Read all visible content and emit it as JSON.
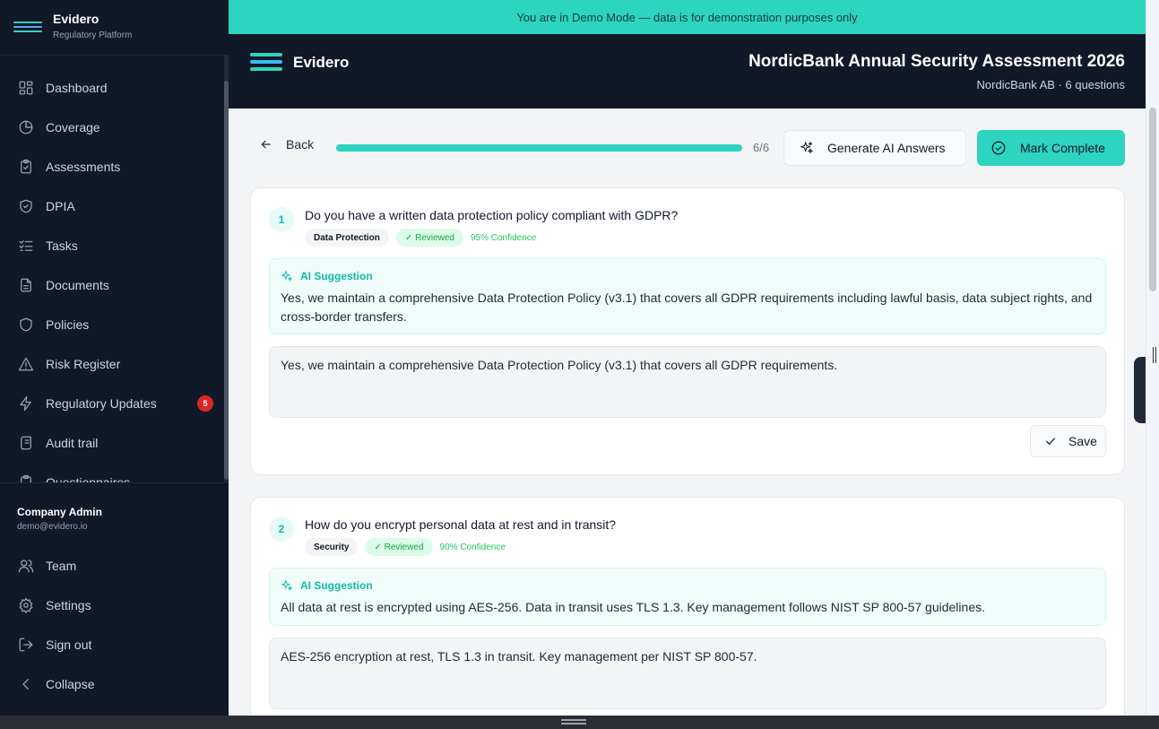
{
  "sidebar": {
    "brand_name": "Evidero",
    "brand_sub": "Regulatory Platform",
    "items": [
      {
        "label": "Dashboard",
        "icon": "dashboard-icon"
      },
      {
        "label": "Coverage",
        "icon": "pie-chart-icon"
      },
      {
        "label": "Assessments",
        "icon": "clipboard-check-icon"
      },
      {
        "label": "DPIA",
        "icon": "shield-check-icon"
      },
      {
        "label": "Tasks",
        "icon": "list-check-icon"
      },
      {
        "label": "Documents",
        "icon": "document-icon"
      },
      {
        "label": "Policies",
        "icon": "shield-icon"
      },
      {
        "label": "Risk Register",
        "icon": "warning-triangle-icon"
      },
      {
        "label": "Regulatory Updates",
        "icon": "lightning-icon",
        "badge": "5"
      },
      {
        "label": "Audit trail",
        "icon": "scroll-icon"
      },
      {
        "label": "Questionnaires",
        "icon": "clipboard-icon"
      }
    ],
    "user": {
      "name": "Company Admin",
      "email": "demo@evidero.io"
    },
    "bottom_items": [
      {
        "label": "Team",
        "icon": "users-icon"
      },
      {
        "label": "Settings",
        "icon": "gear-icon"
      },
      {
        "label": "Sign out",
        "icon": "sign-out-icon"
      },
      {
        "label": "Collapse",
        "icon": "chevron-left-icon"
      }
    ]
  },
  "banner": "You are in Demo Mode — data is for demonstration purposes only",
  "header": {
    "brand": "Evidero",
    "title": "NordicBank Annual Security Assessment 2026",
    "subtitle": "NordicBank AB · 6 questions"
  },
  "toolbar": {
    "back_label": "Back",
    "progress_fraction": 1.0,
    "progress_count": "6/6",
    "generate_label": "Generate AI Answers",
    "complete_label": "Mark Complete"
  },
  "questions": [
    {
      "number": "1",
      "text": "Do you have a written data protection policy compliant with GDPR?",
      "category": "Data Protection",
      "status": "✓ Reviewed",
      "confidence": "95% Confidence",
      "ai_label": "AI Suggestion",
      "ai_text": "Yes, we maintain a comprehensive Data Protection Policy (v3.1) that covers all GDPR requirements including lawful basis, data subject rights, and cross-border transfers.",
      "answer": "Yes, we maintain a comprehensive Data Protection Policy (v3.1) that covers all GDPR requirements.",
      "save_label": "Save"
    },
    {
      "number": "2",
      "text": "How do you encrypt personal data at rest and in transit?",
      "category": "Security",
      "status": "✓ Reviewed",
      "confidence": "90% Confidence",
      "ai_label": "AI Suggestion",
      "ai_text": "All data at rest is encrypted using AES-256. Data in transit uses TLS 1.3. Key management follows NIST SP 800-57 guidelines.",
      "answer": "AES-256 encryption at rest, TLS 1.3 in transit. Key management per NIST SP 800-57.",
      "save_label": "Save"
    }
  ],
  "colors": {
    "accent": "#2dd4bf",
    "sidebar": "#111827",
    "badge": "#dc2626"
  }
}
